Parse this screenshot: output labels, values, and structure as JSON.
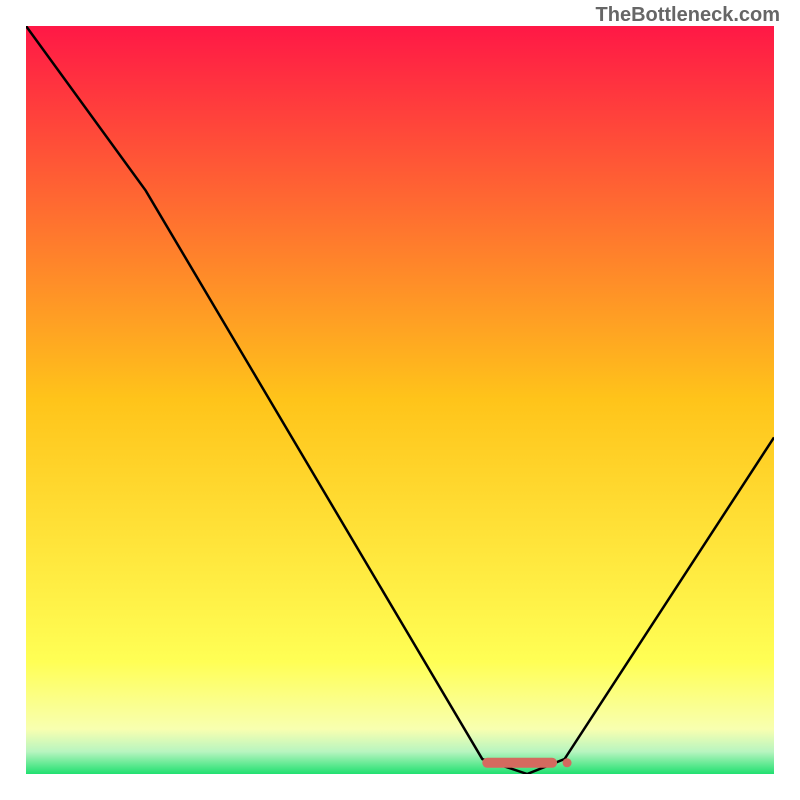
{
  "watermark": "TheBottleneck.com",
  "chart_data": {
    "type": "line",
    "title": "",
    "xlabel": "",
    "ylabel": "",
    "xlim": [
      0,
      100
    ],
    "ylim": [
      0,
      100
    ],
    "series": [
      {
        "name": "bottleneck-curve",
        "x": [
          0,
          16,
          61,
          67,
          72,
          100
        ],
        "y": [
          100,
          78,
          2,
          0,
          2,
          45
        ]
      }
    ],
    "marker_region": {
      "x_start": 61,
      "x_end": 71,
      "y": 1.5,
      "color": "#d46a5f"
    },
    "gradient_stops": [
      {
        "offset": 0,
        "color": "#ff1846"
      },
      {
        "offset": 50,
        "color": "#ffc41a"
      },
      {
        "offset": 85,
        "color": "#ffff55"
      },
      {
        "offset": 94,
        "color": "#f8ffb0"
      },
      {
        "offset": 97,
        "color": "#b8f5c0"
      },
      {
        "offset": 100,
        "color": "#20e070"
      }
    ]
  }
}
